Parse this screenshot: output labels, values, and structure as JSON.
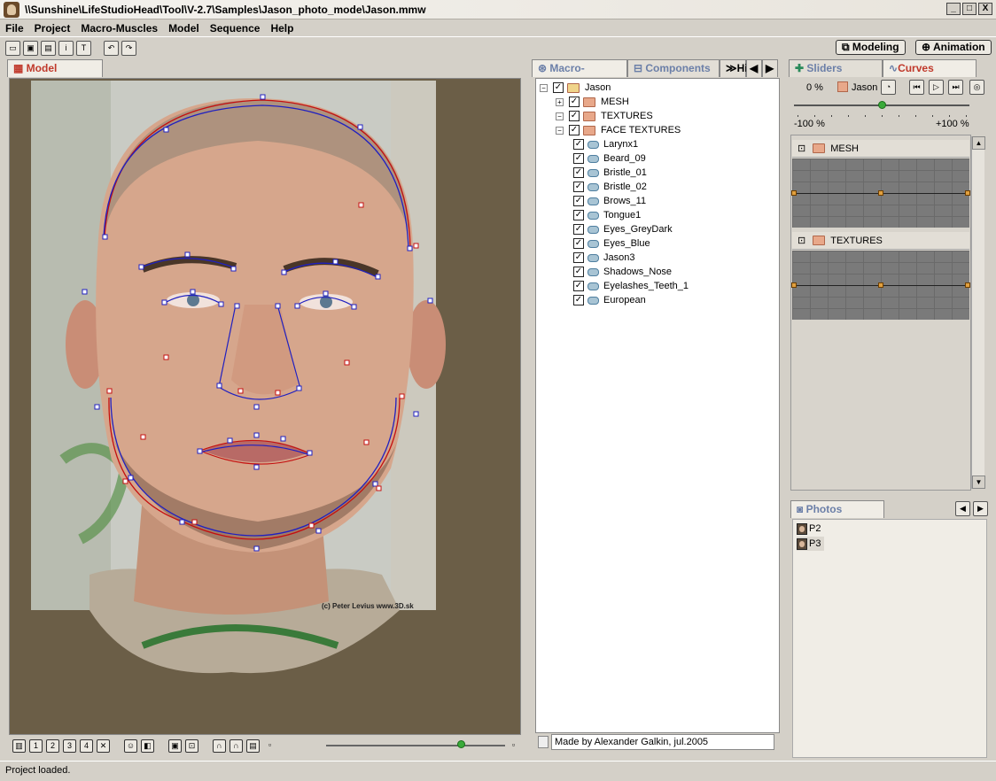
{
  "window": {
    "title": "\\\\Sunshine\\LifeStudioHead\\Tool\\V-2.7\\Samples\\Jason_photo_mode\\Jason.mmw",
    "minimize": "_",
    "maximize": "□",
    "close": "X"
  },
  "menu": [
    "File",
    "Project",
    "Macro-Muscles",
    "Model",
    "Sequence",
    "Help"
  ],
  "toolbar": {
    "modeling_label": "Modeling",
    "animation_label": "Animation"
  },
  "model_panel": {
    "tab_label": "Model",
    "photo_credit": "(c) Peter Levius www.3D.sk",
    "bottom_buttons": [
      "1",
      "2",
      "3",
      "4"
    ]
  },
  "middle_panel": {
    "tabs": [
      "Macro-Muscles",
      "Components",
      "Hi"
    ],
    "tree": [
      {
        "label": "Jason",
        "level": 0,
        "type": "folder-open",
        "expander": "−"
      },
      {
        "label": "MESH",
        "level": 1,
        "type": "folder",
        "expander": "+"
      },
      {
        "label": "TEXTURES",
        "level": 1,
        "type": "folder",
        "expander": "−"
      },
      {
        "label": "FACE TEXTURES",
        "level": 2,
        "type": "folder",
        "expander": "−"
      },
      {
        "label": "Larynx1",
        "level": 3,
        "type": "texture"
      },
      {
        "label": "Beard_09",
        "level": 3,
        "type": "texture"
      },
      {
        "label": "Bristle_01",
        "level": 3,
        "type": "texture"
      },
      {
        "label": "Bristle_02",
        "level": 3,
        "type": "texture"
      },
      {
        "label": "Brows_11",
        "level": 3,
        "type": "texture"
      },
      {
        "label": "Tongue1",
        "level": 3,
        "type": "texture"
      },
      {
        "label": "Eyes_GreyDark",
        "level": 3,
        "type": "texture"
      },
      {
        "label": "Eyes_Blue",
        "level": 3,
        "type": "texture"
      },
      {
        "label": "Jason3",
        "level": 3,
        "type": "texture"
      },
      {
        "label": "Shadows_Nose",
        "level": 3,
        "type": "texture"
      },
      {
        "label": "Eyelashes_Teeth_1",
        "level": 3,
        "type": "texture"
      },
      {
        "label": "European",
        "level": 3,
        "type": "texture"
      }
    ],
    "status_text": "Made by Alexander Galkin, jul.2005"
  },
  "right_panel": {
    "tabs": [
      "Sliders",
      "Curves"
    ],
    "percent": "0 %",
    "target": "Jason",
    "slider_min": "-100 %",
    "slider_max": "+100 %",
    "slider_value": 0.5,
    "curve_groups": [
      "MESH",
      "TEXTURES"
    ]
  },
  "photos_panel": {
    "tab_label": "Photos",
    "items": [
      "P2",
      "P3"
    ]
  },
  "statusbar": {
    "text": "Project loaded."
  }
}
